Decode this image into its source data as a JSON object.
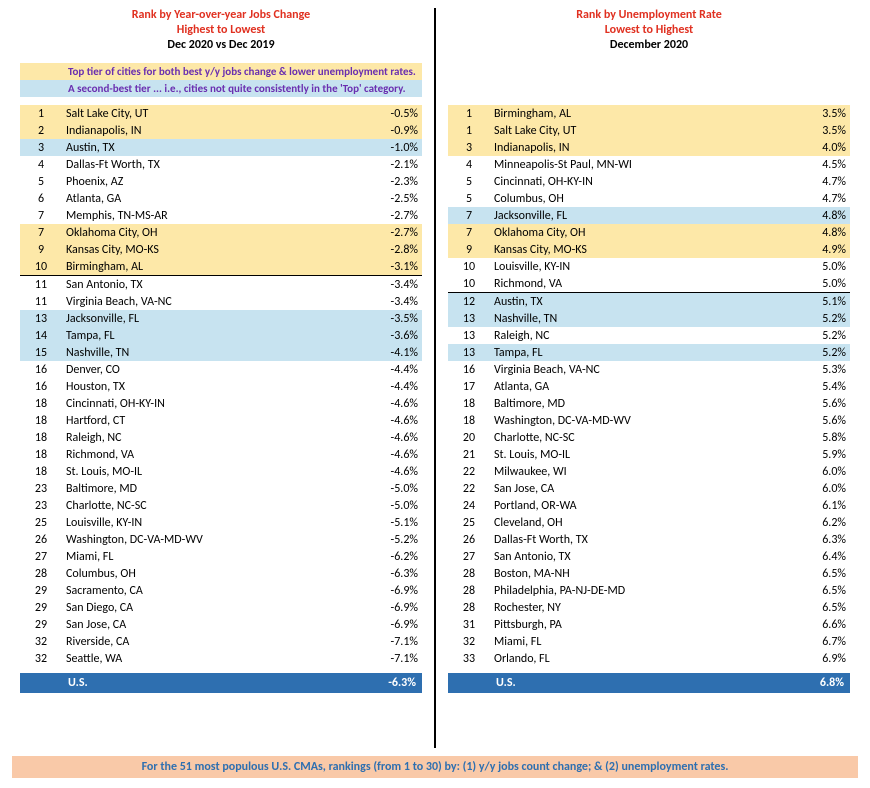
{
  "left": {
    "title1": "Rank by Year-over-year Jobs Change",
    "title2": "Highest to Lowest",
    "subtitle": "Dec 2020 vs Dec 2019",
    "legend1": "Top tier of cities for both best y/y jobs change & lower unemployment rates.",
    "legend2": "A second-best tier ... i.e., cities not quite consistently in the 'Top' category.",
    "rows": [
      {
        "rank": "1",
        "city": "Salt Lake City, UT",
        "val": "-0.5%",
        "tier": "tier1"
      },
      {
        "rank": "2",
        "city": "Indianapolis, IN",
        "val": "-0.9%",
        "tier": "tier1"
      },
      {
        "rank": "3",
        "city": "Austin, TX",
        "val": "-1.0%",
        "tier": "tier2"
      },
      {
        "rank": "4",
        "city": "Dallas-Ft Worth, TX",
        "val": "-2.1%",
        "tier": ""
      },
      {
        "rank": "5",
        "city": "Phoenix, AZ",
        "val": "-2.3%",
        "tier": ""
      },
      {
        "rank": "6",
        "city": "Atlanta, GA",
        "val": "-2.5%",
        "tier": ""
      },
      {
        "rank": "7",
        "city": "Memphis, TN-MS-AR",
        "val": "-2.7%",
        "tier": ""
      },
      {
        "rank": "7",
        "city": "Oklahoma City, OH",
        "val": "-2.7%",
        "tier": "tier1"
      },
      {
        "rank": "9",
        "city": "Kansas City, MO-KS",
        "val": "-2.8%",
        "tier": "tier1"
      },
      {
        "rank": "10",
        "city": "Birmingham, AL",
        "val": "-3.1%",
        "tier": "tier1",
        "brk": true
      },
      {
        "rank": "11",
        "city": "San Antonio, TX",
        "val": "-3.4%",
        "tier": ""
      },
      {
        "rank": "11",
        "city": "Virginia Beach, VA-NC",
        "val": "-3.4%",
        "tier": ""
      },
      {
        "rank": "13",
        "city": "Jacksonville, FL",
        "val": "-3.5%",
        "tier": "tier2"
      },
      {
        "rank": "14",
        "city": "Tampa, FL",
        "val": "-3.6%",
        "tier": "tier2"
      },
      {
        "rank": "15",
        "city": "Nashville, TN",
        "val": "-4.1%",
        "tier": "tier2"
      },
      {
        "rank": "16",
        "city": "Denver, CO",
        "val": "-4.4%",
        "tier": ""
      },
      {
        "rank": "16",
        "city": "Houston, TX",
        "val": "-4.4%",
        "tier": ""
      },
      {
        "rank": "18",
        "city": "Cincinnati, OH-KY-IN",
        "val": "-4.6%",
        "tier": ""
      },
      {
        "rank": "18",
        "city": "Hartford, CT",
        "val": "-4.6%",
        "tier": ""
      },
      {
        "rank": "18",
        "city": "Raleigh, NC",
        "val": "-4.6%",
        "tier": ""
      },
      {
        "rank": "18",
        "city": "Richmond, VA",
        "val": "-4.6%",
        "tier": ""
      },
      {
        "rank": "18",
        "city": "St. Louis, MO-IL",
        "val": "-4.6%",
        "tier": ""
      },
      {
        "rank": "23",
        "city": "Baltimore, MD",
        "val": "-5.0%",
        "tier": ""
      },
      {
        "rank": "23",
        "city": "Charlotte, NC-SC",
        "val": "-5.0%",
        "tier": ""
      },
      {
        "rank": "25",
        "city": "Louisville, KY-IN",
        "val": "-5.1%",
        "tier": ""
      },
      {
        "rank": "26",
        "city": "Washington, DC-VA-MD-WV",
        "val": "-5.2%",
        "tier": ""
      },
      {
        "rank": "27",
        "city": "Miami, FL",
        "val": "-6.2%",
        "tier": ""
      },
      {
        "rank": "28",
        "city": "Columbus, OH",
        "val": "-6.3%",
        "tier": ""
      },
      {
        "rank": "29",
        "city": "Sacramento, CA",
        "val": "-6.9%",
        "tier": ""
      },
      {
        "rank": "29",
        "city": "San Diego, CA",
        "val": "-6.9%",
        "tier": ""
      },
      {
        "rank": "29",
        "city": "San Jose, CA",
        "val": "-6.9%",
        "tier": ""
      },
      {
        "rank": "32",
        "city": "Riverside, CA",
        "val": "-7.1%",
        "tier": ""
      },
      {
        "rank": "32",
        "city": "Seattle, WA",
        "val": "-7.1%",
        "tier": ""
      }
    ],
    "us_label": "U.S.",
    "us_val": "-6.3%"
  },
  "right": {
    "title1": "Rank by Unemployment Rate",
    "title2": "Lowest to Highest",
    "subtitle": "December 2020",
    "rows": [
      {
        "rank": "1",
        "city": "Birmingham, AL",
        "val": "3.5%",
        "tier": "tier1"
      },
      {
        "rank": "1",
        "city": "Salt Lake City, UT",
        "val": "3.5%",
        "tier": "tier1"
      },
      {
        "rank": "3",
        "city": "Indianapolis, IN",
        "val": "4.0%",
        "tier": "tier1"
      },
      {
        "rank": "4",
        "city": "Minneapolis-St Paul, MN-WI",
        "val": "4.5%",
        "tier": ""
      },
      {
        "rank": "5",
        "city": "Cincinnati, OH-KY-IN",
        "val": "4.7%",
        "tier": ""
      },
      {
        "rank": "5",
        "city": "Columbus, OH",
        "val": "4.7%",
        "tier": ""
      },
      {
        "rank": "7",
        "city": "Jacksonville, FL",
        "val": "4.8%",
        "tier": "tier2"
      },
      {
        "rank": "7",
        "city": "Oklahoma City, OH",
        "val": "4.8%",
        "tier": "tier1"
      },
      {
        "rank": "9",
        "city": "Kansas City, MO-KS",
        "val": "4.9%",
        "tier": "tier1"
      },
      {
        "rank": "10",
        "city": "Louisville, KY-IN",
        "val": "5.0%",
        "tier": ""
      },
      {
        "rank": "10",
        "city": "Richmond, VA",
        "val": "5.0%",
        "tier": "",
        "brk": true
      },
      {
        "rank": "12",
        "city": "Austin, TX",
        "val": "5.1%",
        "tier": "tier2"
      },
      {
        "rank": "13",
        "city": "Nashville, TN",
        "val": "5.2%",
        "tier": "tier2"
      },
      {
        "rank": "13",
        "city": "Raleigh, NC",
        "val": "5.2%",
        "tier": ""
      },
      {
        "rank": "13",
        "city": "Tampa, FL",
        "val": "5.2%",
        "tier": "tier2"
      },
      {
        "rank": "16",
        "city": "Virginia Beach, VA-NC",
        "val": "5.3%",
        "tier": ""
      },
      {
        "rank": "17",
        "city": "Atlanta, GA",
        "val": "5.4%",
        "tier": ""
      },
      {
        "rank": "18",
        "city": "Baltimore, MD",
        "val": "5.6%",
        "tier": ""
      },
      {
        "rank": "18",
        "city": "Washington, DC-VA-MD-WV",
        "val": "5.6%",
        "tier": ""
      },
      {
        "rank": "20",
        "city": "Charlotte, NC-SC",
        "val": "5.8%",
        "tier": ""
      },
      {
        "rank": "21",
        "city": "St. Louis, MO-IL",
        "val": "5.9%",
        "tier": ""
      },
      {
        "rank": "22",
        "city": "Milwaukee, WI",
        "val": "6.0%",
        "tier": ""
      },
      {
        "rank": "22",
        "city": "San Jose, CA",
        "val": "6.0%",
        "tier": ""
      },
      {
        "rank": "24",
        "city": "Portland, OR-WA",
        "val": "6.1%",
        "tier": ""
      },
      {
        "rank": "25",
        "city": "Cleveland, OH",
        "val": "6.2%",
        "tier": ""
      },
      {
        "rank": "26",
        "city": "Dallas-Ft Worth, TX",
        "val": "6.3%",
        "tier": ""
      },
      {
        "rank": "27",
        "city": "San Antonio, TX",
        "val": "6.4%",
        "tier": ""
      },
      {
        "rank": "28",
        "city": "Boston, MA-NH",
        "val": "6.5%",
        "tier": ""
      },
      {
        "rank": "28",
        "city": "Philadelphia, PA-NJ-DE-MD",
        "val": "6.5%",
        "tier": ""
      },
      {
        "rank": "28",
        "city": "Rochester, NY",
        "val": "6.5%",
        "tier": ""
      },
      {
        "rank": "31",
        "city": "Pittsburgh, PA",
        "val": "6.6%",
        "tier": ""
      },
      {
        "rank": "32",
        "city": "Miami, FL",
        "val": "6.7%",
        "tier": ""
      },
      {
        "rank": "33",
        "city": "Orlando, FL",
        "val": "6.9%",
        "tier": ""
      }
    ],
    "us_label": "U.S.",
    "us_val": "6.8%"
  },
  "footer": "For the 51 most populous U.S. CMAs, rankings (from 1 to 30) by: (1) y/y jobs count change; & (2) unemployment rates."
}
